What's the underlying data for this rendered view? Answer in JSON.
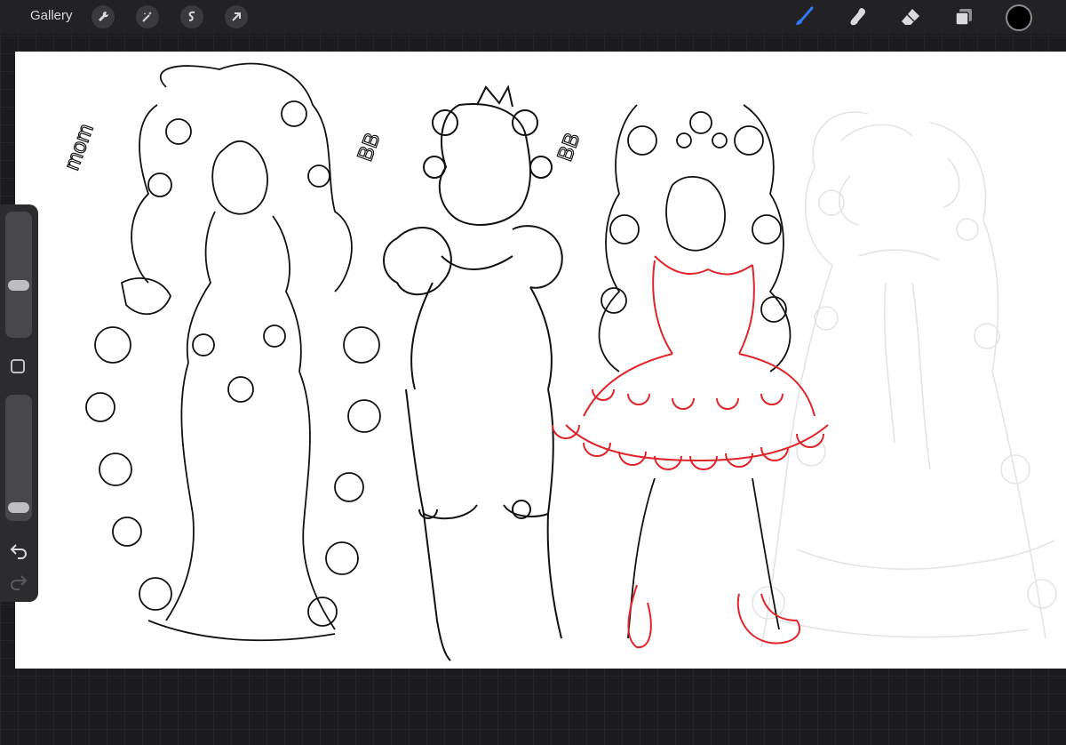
{
  "topbar": {
    "gallery_label": "Gallery",
    "left_tools": [
      "wrench-icon",
      "magic-wand-icon",
      "selection-icon",
      "transform-arrow-icon"
    ],
    "right_tools": [
      "brush-icon",
      "smudge-icon",
      "eraser-icon",
      "layers-icon"
    ],
    "current_color": "#000000",
    "active_tool_color": "#2f7bf6"
  },
  "canvas": {
    "labels": {
      "mom": "mom",
      "bb_1": "BB",
      "bb_2": "BB"
    },
    "line_color": "#111111",
    "accent_color": "#e0242a",
    "ghost_color": "#e2e2e2"
  },
  "sidebar": {
    "brush_size_level": 0.6,
    "opacity_level": 0.95
  }
}
